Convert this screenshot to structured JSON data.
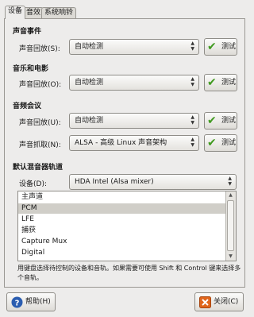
{
  "tabs": [
    {
      "label": "设备",
      "active": true
    },
    {
      "label": "音效",
      "active": false
    },
    {
      "label": "系统响铃",
      "active": false
    }
  ],
  "sound_events": {
    "title": "声音事件",
    "playback_label": "声音回放(S):",
    "playback_value": "自动检测",
    "test_label": "测试"
  },
  "music_movies": {
    "title": "音乐和电影",
    "playback_label": "声音回放(O):",
    "playback_value": "自动检测",
    "test_label": "测试"
  },
  "audio_conference": {
    "title": "音频会议",
    "playback_label": "声音回放(U):",
    "playback_value": "自动检测",
    "capture_label": "声音抓取(N):",
    "capture_value": "ALSA - 高级 Linux 声音架构",
    "test_label": "测试"
  },
  "mixer": {
    "title": "默认混音器轨道",
    "device_label": "设备(D):",
    "device_value": "HDA Intel (Alsa mixer)",
    "tracks": [
      "主声道",
      "PCM",
      "LFE",
      "捕获",
      "Capture Mux",
      "Digital"
    ],
    "selected_index": 1,
    "hint": "用键盘选择待控制的设备和音轨。如果需要可使用 Shift 和 Control 键来选择多个音轨。"
  },
  "footer": {
    "help_label": "帮助(H)",
    "close_label": "关闭(C)"
  },
  "colors": {
    "check_green": "#3f9a1f",
    "close_icon_orange": "#e0651b",
    "help_icon_blue": "#2a5db0"
  },
  "icons": [
    "check-icon",
    "help-icon",
    "close-icon",
    "combo-arrows-icon"
  ]
}
